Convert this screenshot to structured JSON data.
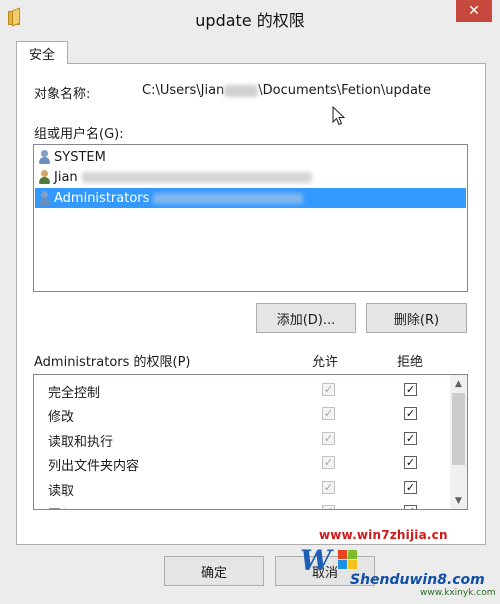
{
  "window": {
    "title": "update 的权限",
    "close_label": "✕"
  },
  "tabs": [
    {
      "label": "安全"
    }
  ],
  "object": {
    "label": "对象名称:",
    "path_prefix": "C:\\Users\\Jian",
    "path_suffix": "\\Documents\\Fetion\\update"
  },
  "groups": {
    "label": "组或用户名(G):",
    "items": [
      {
        "name": "SYSTEM"
      },
      {
        "name": "Jian"
      },
      {
        "name": "Administrators"
      }
    ]
  },
  "buttons": {
    "add": "添加(D)...",
    "remove": "删除(R)",
    "ok": "确定",
    "cancel": "取消"
  },
  "permissions": {
    "title": "Administrators 的权限(P)",
    "allow_label": "允许",
    "deny_label": "拒绝",
    "items": [
      {
        "name": "完全控制",
        "allow": true,
        "deny": true
      },
      {
        "name": "修改",
        "allow": true,
        "deny": true
      },
      {
        "name": "读取和执行",
        "allow": true,
        "deny": true
      },
      {
        "name": "列出文件夹内容",
        "allow": true,
        "deny": true
      },
      {
        "name": "读取",
        "allow": true,
        "deny": true
      },
      {
        "name": "写入",
        "allow": true,
        "deny": true
      }
    ]
  },
  "icons": {
    "check": "✓",
    "scroll_up": "▲",
    "scroll_down": "▼"
  },
  "watermark": {
    "url": "www.win7zhijia.cn",
    "site": "Shenduwin8.com",
    "site2": "www.kxinyk.com"
  },
  "colors": {
    "selection": "#3399ff",
    "close": "#c7483d"
  }
}
